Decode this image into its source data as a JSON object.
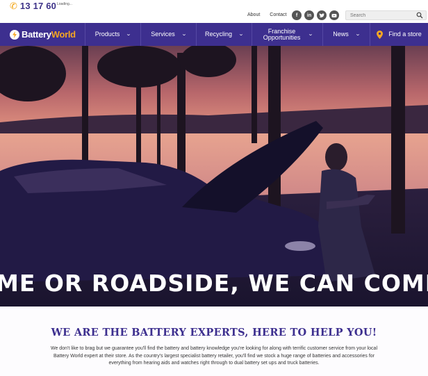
{
  "topbar": {
    "phone_number": "13 17 60",
    "loading_text": "Loading...",
    "links": [
      "About",
      "Contact"
    ],
    "social_icons": [
      "facebook-icon",
      "linkedin-icon",
      "twitter-icon",
      "youtube-icon"
    ],
    "search_placeholder": "Search"
  },
  "nav": {
    "logo_text_1": "Battery",
    "logo_text_2": "World",
    "items": [
      {
        "label": "Products"
      },
      {
        "label": "Services"
      },
      {
        "label": "Recycling"
      },
      {
        "label": "Franchise Opportunities"
      },
      {
        "label": "News"
      }
    ],
    "find_store_label": "Find a store"
  },
  "hero": {
    "caption": "ME OR ROADSIDE, WE CAN COME TO Y"
  },
  "intro": {
    "heading": "WE ARE THE BATTERY EXPERTS, HERE TO HELP YOU!",
    "body": "We don't like to brag but we guarantee you'll find the battery and battery knowledge you're looking for along with terrific customer service from your local Battery World expert at their store. As the country's largest specialist battery retailer, you'll find we stock a huge range of batteries and accessories for everything from hearing aids and watches right through to dual battery set ups and truck batteries."
  },
  "colors": {
    "brand_purple": "#3d2f8f",
    "accent_orange": "#f2a20c"
  }
}
